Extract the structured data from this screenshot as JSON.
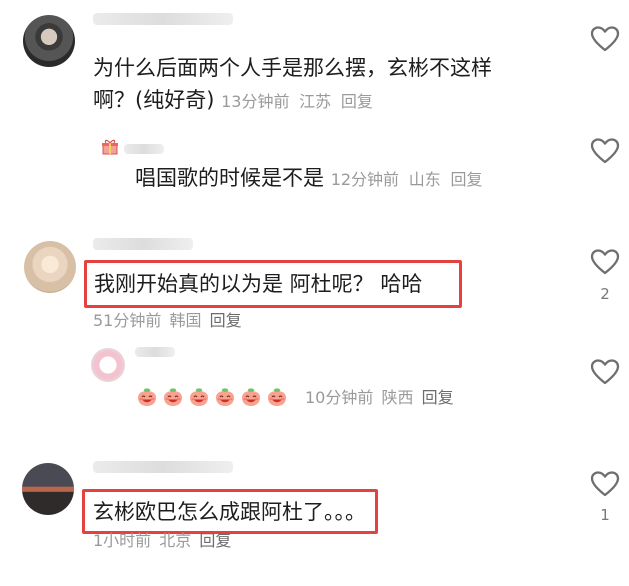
{
  "comments": [
    {
      "text": "为什么后面两个人手是那么摆，玄彬不这样",
      "text2": "啊？(纯好奇)",
      "time": "13分钟前",
      "location": "江苏",
      "reply_label": "回复",
      "likes": ""
    },
    {
      "text": "唱国歌的时候是不是",
      "time": "12分钟前",
      "location": "山东",
      "reply_label": "回复",
      "likes": ""
    },
    {
      "text": "我刚开始真的以为是 阿杜呢？ 哈哈",
      "time": "51分钟前",
      "location": "韩国",
      "reply_label": "回复",
      "likes": "2"
    },
    {
      "text": "",
      "time": "10分钟前",
      "location": "陕西",
      "reply_label": "回复",
      "likes": "",
      "emoji_count": 6
    },
    {
      "text": "玄彬欧巴怎么成跟阿杜了。。。",
      "time": "1小时前",
      "location": "北京",
      "reply_label": "回复",
      "likes": "1"
    }
  ],
  "colors": {
    "highlight_box": "#e5423f",
    "meta_text": "#9a9a9a",
    "reply_text": "#6c6c6c",
    "heart_stroke": "#6f6f6f"
  },
  "icons": {
    "like": "heart-outline-icon",
    "badge": "gift-icon",
    "emoji": "peach-face-emoji"
  }
}
